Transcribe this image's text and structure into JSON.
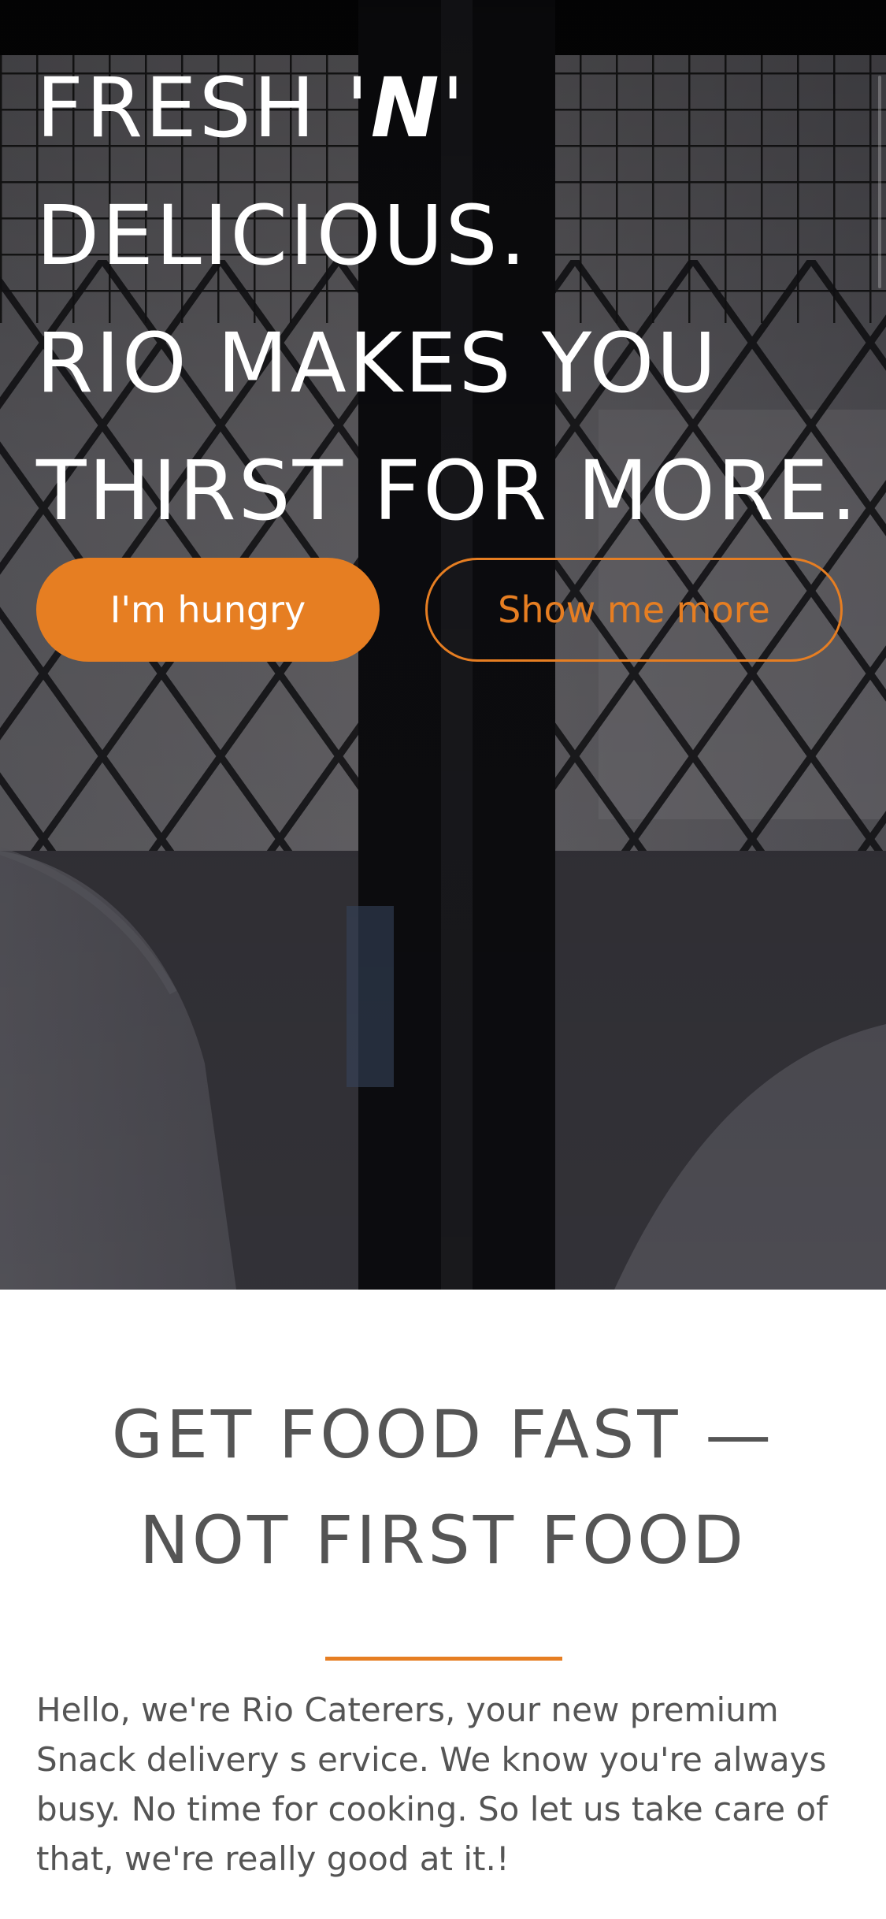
{
  "hero": {
    "title_line1_prefix": "FRESH '",
    "title_line1_em": "N",
    "title_line1_suffix": "'",
    "title_line2": "DELICIOUS.",
    "title_line3": "RIO MAKES YOU",
    "title_line4": "THIRST FOR MORE.",
    "primary_button_label": "I'm hungry",
    "secondary_button_label": "Show me more"
  },
  "intro": {
    "title_line1": "GET FOOD FAST —",
    "title_line2": "NOT FIRST FOOD",
    "body": "Hello, we're Rio Caterers, your new premium Snack delivery s ervice. We know you're always busy. No time for cooking. So let us take care of that, we're really good at it.!"
  },
  "colors": {
    "accent": "#e67e22",
    "heading_text": "#555555",
    "hero_text": "#ffffff"
  }
}
